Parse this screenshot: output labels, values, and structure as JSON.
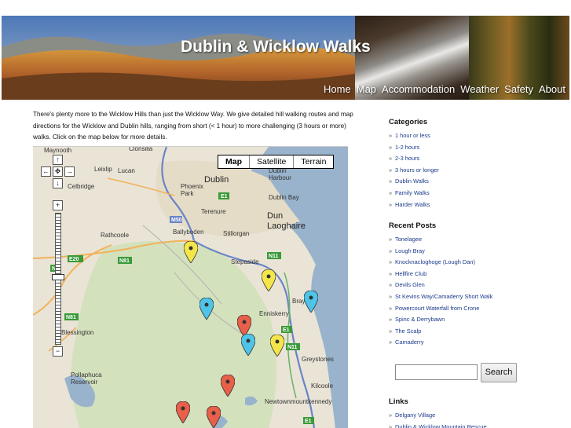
{
  "site": {
    "title": "Dublin & Wicklow Walks"
  },
  "nav": [
    "Home",
    "Map",
    "Accommodation",
    "Weather",
    "Safety",
    "About"
  ],
  "intro": "There's plenty more to the Wicklow Hills than just the Wicklow Way. We give detailed hill walking routes and map directions for the Wicklow and Dublin hills, ranging from short (< 1 hour) to more challenging (3 hours or more) walks. Click on the map below for more details.",
  "map": {
    "types": [
      "Map",
      "Satellite",
      "Terrain"
    ],
    "selected_type": "Map",
    "labels": {
      "maynooth": "Maynooth",
      "clonsilla": "Clonsilla",
      "leixlip": "Leixlip",
      "lucan": "Lucan",
      "celbridge": "Celbridge",
      "phoenix_park": "Phoenix Park",
      "dublin": "Dublin",
      "dublin_harbour": "Dublin Harbour",
      "dublin_bay": "Dublin Bay",
      "terenure": "Terenure",
      "dun_laoghaire": "Dun Laoghaire",
      "rathcoole": "Rathcoole",
      "ballyboden": "Ballyboden",
      "stillorgan": "Stillorgan",
      "stepaside": "Stepaside",
      "enniskerry": "Enniskerry",
      "bray": "Bray",
      "blessington": "Blessington",
      "greystones": "Greystones",
      "pollaphuca": "Pollaphuca Reservoir",
      "kilcoole": "Kilcoole",
      "newtownmountkennedy": "Newtownmountkennedy"
    },
    "road_shields": [
      "M50",
      "E1",
      "E20",
      "N81",
      "N7",
      "N11",
      "E1",
      "N11",
      "N81",
      "E1"
    ],
    "markers": [
      {
        "color": "#f4e64a"
      },
      {
        "color": "#f4e64a"
      },
      {
        "color": "#4fc4e8"
      },
      {
        "color": "#4fc4e8"
      },
      {
        "color": "#e8604a"
      },
      {
        "color": "#4fc4e8"
      },
      {
        "color": "#f4e64a"
      },
      {
        "color": "#e8604a"
      },
      {
        "color": "#e8604a"
      },
      {
        "color": "#e8604a"
      }
    ],
    "pan_icons": [
      "arrow-up-icon",
      "arrow-left-icon",
      "center-icon",
      "arrow-right-icon",
      "arrow-down-icon"
    ],
    "zoom_in": "+",
    "zoom_out": "−"
  },
  "sidebar": {
    "categories_title": "Categories",
    "categories": [
      "1 hour or less",
      "1-2 hours",
      "2-3 hours",
      "3 hours or longer",
      "Dublin Walks",
      "Family Walks",
      "Harder Walks"
    ],
    "recent_title": "Recent Posts",
    "recent": [
      "Tonelagee",
      "Lough Bray",
      "Knocknacloghoge (Lough Dan)",
      "Hellfire Club",
      "Devils Glen",
      "St Kevins Way/Camaderry Short Walk",
      "Powercourt Waterfall from Crone",
      "Spinc & Derrybawn",
      "The Scalp",
      "Camaderry"
    ],
    "search_placeholder": "",
    "search_button": "Search",
    "links_title": "Links",
    "links": [
      "Delgany Village",
      "Dublin & Wicklow Mountain Rescue"
    ]
  }
}
